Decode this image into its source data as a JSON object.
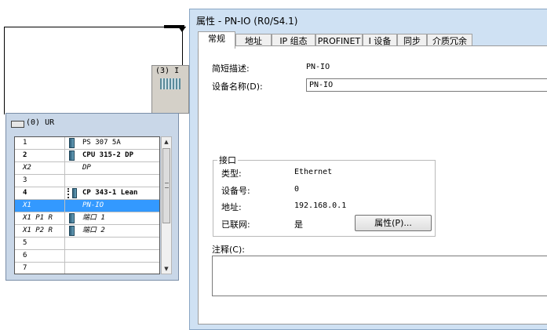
{
  "station": {
    "label": "(3) I"
  },
  "rack": {
    "title": "(0) UR",
    "rows": [
      {
        "slot": "1",
        "module": "PS 307 5A",
        "bold": false,
        "italic": false,
        "selected": false,
        "icon": "module"
      },
      {
        "slot": "2",
        "module": "CPU 315-2 DP",
        "bold": true,
        "italic": false,
        "selected": false,
        "icon": "module"
      },
      {
        "slot": "X2",
        "module": "DP",
        "bold": false,
        "italic": true,
        "selected": false,
        "icon": "none"
      },
      {
        "slot": "3",
        "module": "",
        "bold": false,
        "italic": false,
        "selected": false,
        "icon": "none"
      },
      {
        "slot": "4",
        "module": "CP 343-1 Lean",
        "bold": true,
        "italic": false,
        "selected": false,
        "icon": "module-dashed"
      },
      {
        "slot": "X1",
        "module": "PN-IO",
        "bold": false,
        "italic": true,
        "selected": true,
        "icon": "none"
      },
      {
        "slot": "X1 P1 R",
        "module": "端口 1",
        "bold": false,
        "italic": true,
        "selected": false,
        "icon": "module"
      },
      {
        "slot": "X1 P2 R",
        "module": "端口 2",
        "bold": false,
        "italic": true,
        "selected": false,
        "icon": "module"
      },
      {
        "slot": "5",
        "module": "",
        "bold": false,
        "italic": false,
        "selected": false,
        "icon": "none"
      },
      {
        "slot": "6",
        "module": "",
        "bold": false,
        "italic": false,
        "selected": false,
        "icon": "none"
      },
      {
        "slot": "7",
        "module": "",
        "bold": false,
        "italic": false,
        "selected": false,
        "icon": "none"
      }
    ]
  },
  "dialog": {
    "title": "属性 - PN-IO (R0/S4.1)",
    "tabs": [
      "常规",
      "地址",
      "IP 组态",
      "PROFINET",
      "I 设备",
      "同步",
      "介质冗余"
    ],
    "active_tab": "常规",
    "short_desc_label": "简短描述:",
    "short_desc_value": "PN-IO",
    "device_name_label": "设备名称(D):",
    "device_name_value": "PN-IO",
    "interface": {
      "title": "接口",
      "type_label": "类型:",
      "type_value": "Ethernet",
      "device_no_label": "设备号:",
      "device_no_value": "0",
      "address_label": "地址:",
      "address_value": "192.168.0.1",
      "networked_label": "已联网:",
      "networked_value": "是",
      "properties_button": "属性(P)..."
    },
    "comment_label": "注释(C):"
  },
  "colors": {
    "selection": "#3399ff",
    "dialog_frame": "#cfe1f3",
    "rack_frame": "#c9d7e8"
  }
}
